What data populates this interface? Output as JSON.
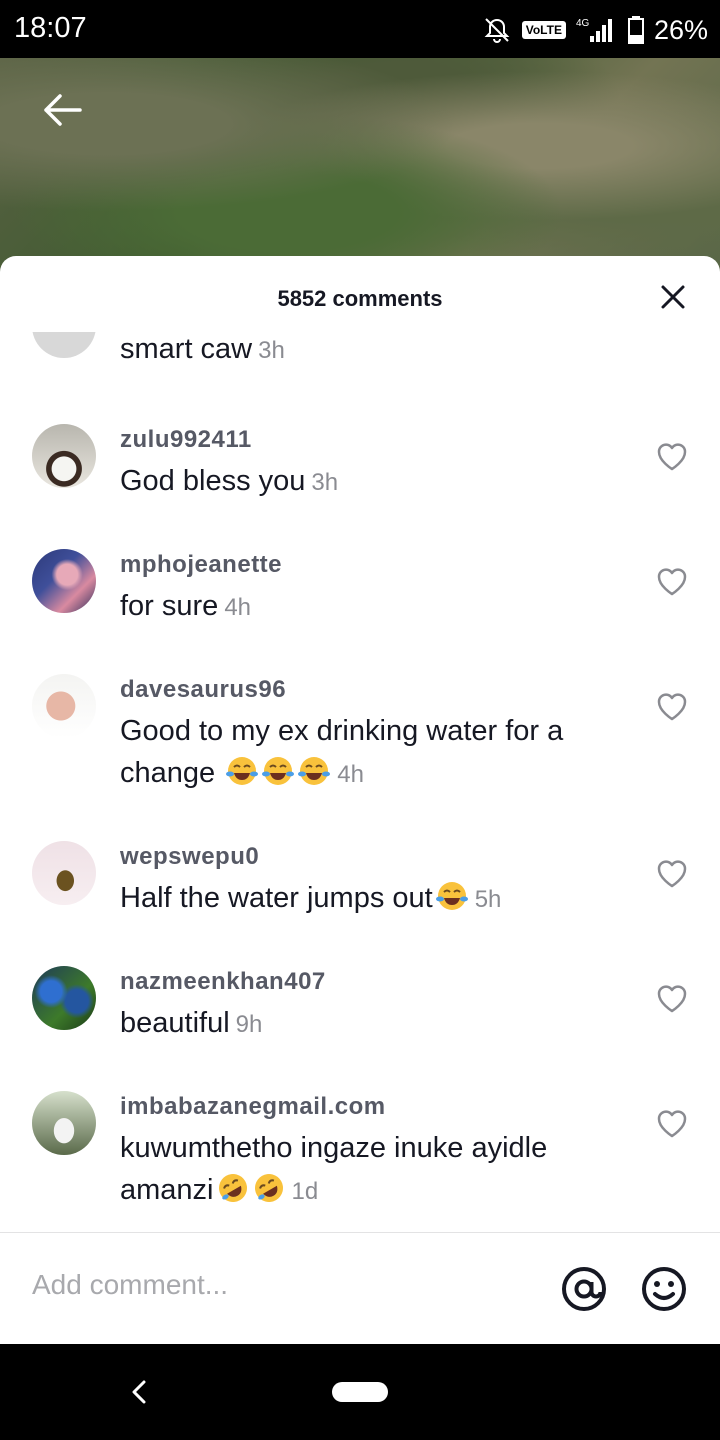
{
  "status_bar": {
    "time": "18:07",
    "network": "VoLTE",
    "signal": "4G",
    "battery": "26%"
  },
  "sheet": {
    "title": "5852 comments"
  },
  "comments": [
    {
      "username": "",
      "text": "smart caw",
      "time": "3h",
      "avatar_colors": [
        "#d8d8d8",
        "#ececec"
      ]
    },
    {
      "username": "zulu992411",
      "text": "God bless you",
      "time": "3h",
      "avatar_colors": [
        "#b8b6ae",
        "#e9e6df"
      ]
    },
    {
      "username": "mphojeanette",
      "text": "for sure",
      "time": "4h",
      "avatar_colors": [
        "#3f4f9a",
        "#d98aa0"
      ]
    },
    {
      "username": "davesaurus96",
      "text": "Good to my ex drinking water for a change",
      "emojis": [
        "tears-of-joy",
        "tears-of-joy",
        "tears-of-joy"
      ],
      "time": "4h",
      "avatar_colors": [
        "#e7ccc0",
        "#ffffff"
      ]
    },
    {
      "username": "wepswepu0",
      "text": "Half the water jumps out",
      "emojis": [
        "tears-of-joy"
      ],
      "time": "5h",
      "avatar_colors": [
        "#f1e4ea",
        "#6b5220"
      ]
    },
    {
      "username": "nazmeenkhan407",
      "text": "beautiful",
      "time": "9h",
      "avatar_colors": [
        "#2a5ea8",
        "#3d7a2a"
      ]
    },
    {
      "username": "imbabazanegmail.com",
      "text": "kuwumthetho ingaze inuke ayidle amanzi",
      "emojis": [
        "rolling-laughing",
        "rolling-laughing"
      ],
      "time": "1d",
      "avatar_colors": [
        "#dfe6d8",
        "#5a6a4a"
      ]
    }
  ],
  "input": {
    "placeholder": "Add comment..."
  },
  "icons": {
    "back": "arrow-left-icon",
    "close": "close-icon",
    "like": "heart-outline-icon",
    "mention": "at-sign-icon",
    "emoji": "smiley-icon"
  },
  "colors": {
    "text_primary": "#161823",
    "username": "#565965",
    "time": "#8a8b91",
    "placeholder": "#a8a9ad"
  }
}
